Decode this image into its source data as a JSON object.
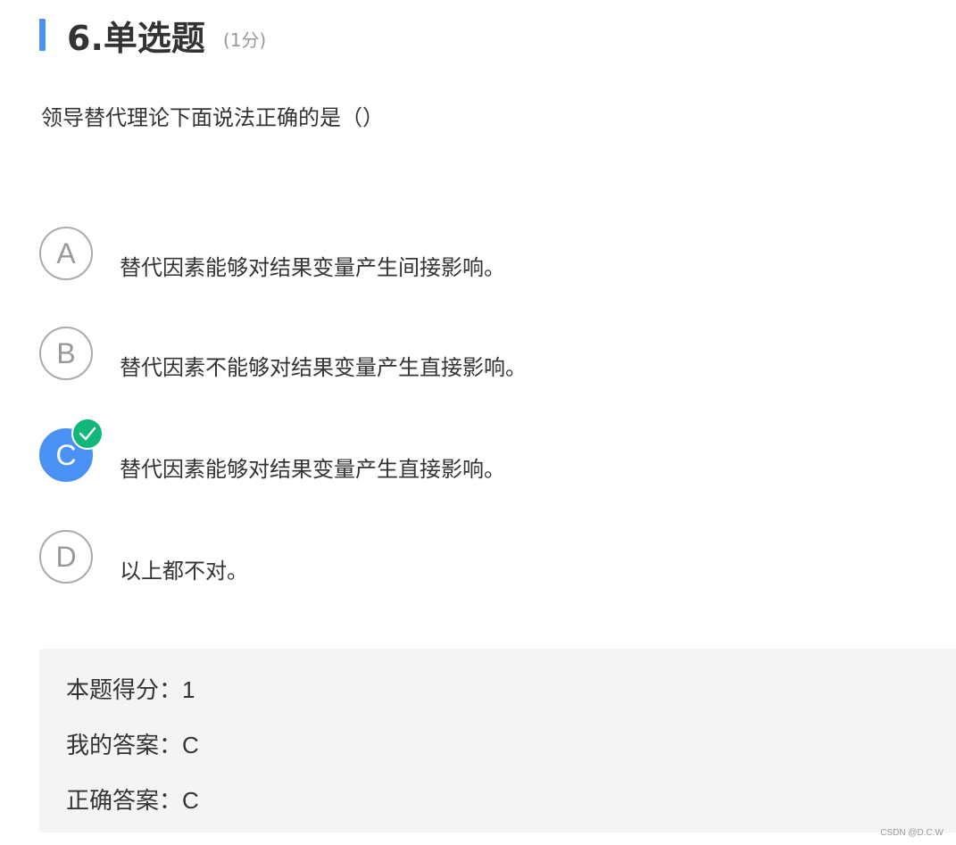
{
  "question": {
    "number_title": "6.单选题",
    "score": "(1分)",
    "stem": "领导替代理论下面说法正确的是（）",
    "accent_color": "#4a90f5"
  },
  "options": [
    {
      "letter": "A",
      "text": "替代因素能够对结果变量产生间接影响。",
      "selected": false
    },
    {
      "letter": "B",
      "text": "替代因素不能够对结果变量产生直接影响。",
      "selected": false
    },
    {
      "letter": "C",
      "text": "替代因素能够对结果变量产生直接影响。",
      "selected": true,
      "correct_icon": "check-icon"
    },
    {
      "letter": "D",
      "text": "以上都不对。",
      "selected": false
    }
  ],
  "result": {
    "score_label": "本题得分：",
    "score_value": "1",
    "my_answer_label": "我的答案：",
    "my_answer_value": "C",
    "correct_answer_label": "正确答案：",
    "correct_answer_value": "C"
  },
  "watermark": "CSDN @D.C.W",
  "colors": {
    "selected": "#4a90f5",
    "correct_badge": "#12b77a"
  }
}
